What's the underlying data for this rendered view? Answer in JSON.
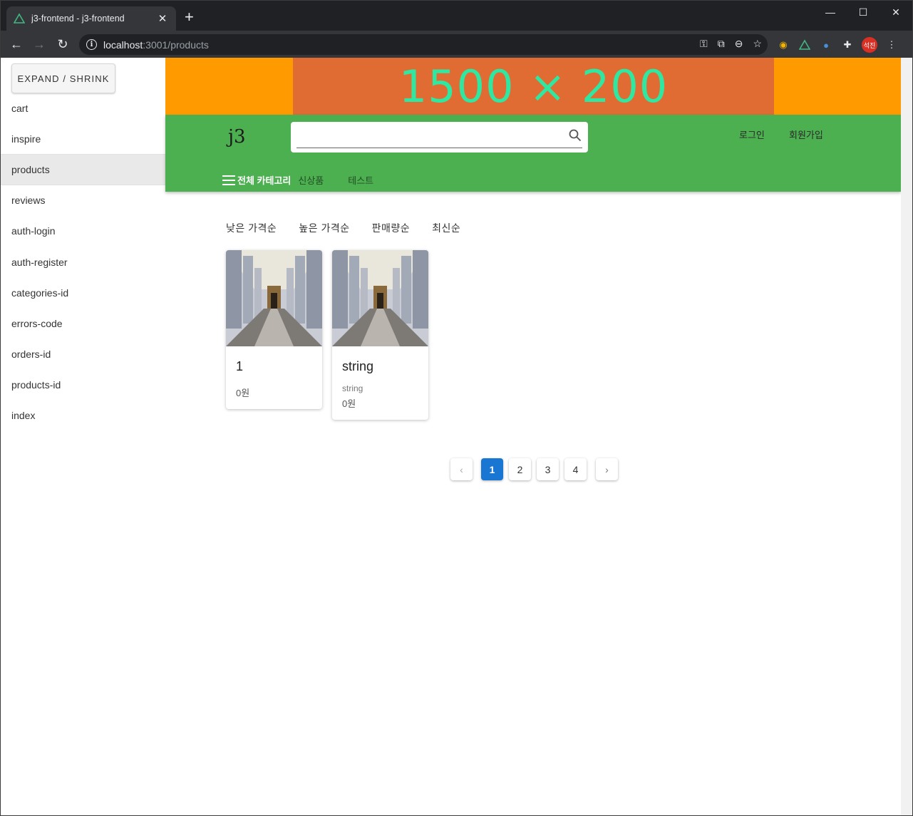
{
  "browser": {
    "tab_title": "j3-frontend - j3-frontend",
    "url_host": "localhost",
    "url_path": ":3001/products",
    "avatar_label": "석진"
  },
  "sidebar": {
    "expand_label": "EXPAND / SHRINK",
    "items": [
      {
        "label": "cart"
      },
      {
        "label": "inspire"
      },
      {
        "label": "products"
      },
      {
        "label": "reviews"
      },
      {
        "label": "auth-login"
      },
      {
        "label": "auth-register"
      },
      {
        "label": "categories-id"
      },
      {
        "label": "errors-code"
      },
      {
        "label": "orders-id"
      },
      {
        "label": "products-id"
      },
      {
        "label": "index"
      }
    ]
  },
  "banner": {
    "text": "1500 × 200"
  },
  "header": {
    "logo": "j3",
    "search_placeholder": "",
    "login_label": "로그인",
    "signup_label": "회원가입",
    "all_categories_label": "전체 카테고리",
    "category_links": [
      "신상품",
      "테스트"
    ]
  },
  "sort_options": [
    "낮은 가격순",
    "높은 가격순",
    "판매량순",
    "최신순"
  ],
  "products": [
    {
      "title": "1",
      "subtitle": "",
      "price": "0원"
    },
    {
      "title": "string",
      "subtitle": "string",
      "price": "0원"
    }
  ],
  "pagination": {
    "pages": [
      "1",
      "2",
      "3",
      "4"
    ],
    "current": "1"
  },
  "colors": {
    "header_green": "#4caf50",
    "banner_orange": "#ff9a00",
    "banner_inner": "#e06c33",
    "banner_text": "#2fe7a0",
    "primary_blue": "#1976d2"
  }
}
